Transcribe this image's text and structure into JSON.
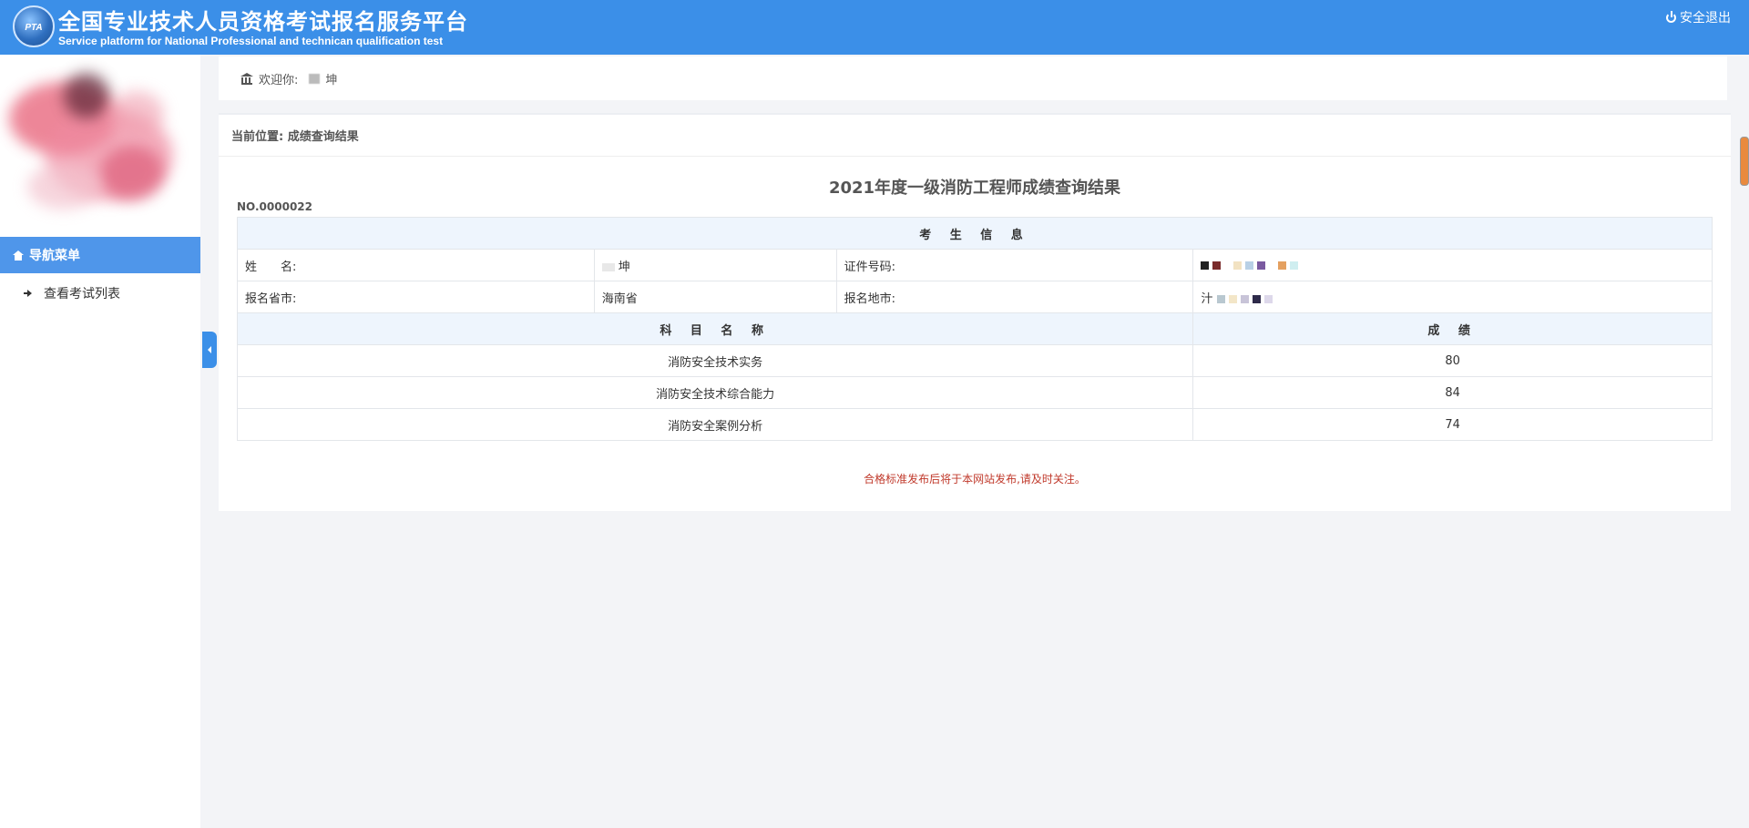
{
  "header": {
    "logo_text": "PTA",
    "title_cn": "全国专业技术人员资格考试报名服务平台",
    "title_en": "Service platform for National Professional and technican qualification test",
    "logout": "安全退出"
  },
  "sidebar": {
    "nav_title": "导航菜单",
    "items": [
      {
        "label": "查看考试列表"
      }
    ]
  },
  "welcome": {
    "prefix": "欢迎你:",
    "name_suffix": "坤"
  },
  "breadcrumb": "当前位置: 成绩查询结果",
  "result": {
    "title": "2021年度一级消防工程师成绩查询结果",
    "number": "NO.0000022",
    "section_title": "考 生 信 息",
    "info": {
      "name_label": "姓　　名:",
      "name_value": "坤",
      "id_label": "证件号码:",
      "province_label": "报名省市:",
      "province_value": "海南省",
      "city_label": "报名地市:",
      "city_value": "汁"
    },
    "subjects_header": "科 目 名 称",
    "score_header": "成 绩",
    "subjects": [
      {
        "name": "消防安全技术实务",
        "score": "80"
      },
      {
        "name": "消防安全技术综合能力",
        "score": "84"
      },
      {
        "name": "消防安全案例分析",
        "score": "74"
      }
    ],
    "notice": "合格标准发布后将于本网站发布,请及时关注。"
  },
  "colors": {
    "header_bg": "#3b8fe8",
    "nav_active": "#4f96ea",
    "notice": "#c0392b"
  }
}
